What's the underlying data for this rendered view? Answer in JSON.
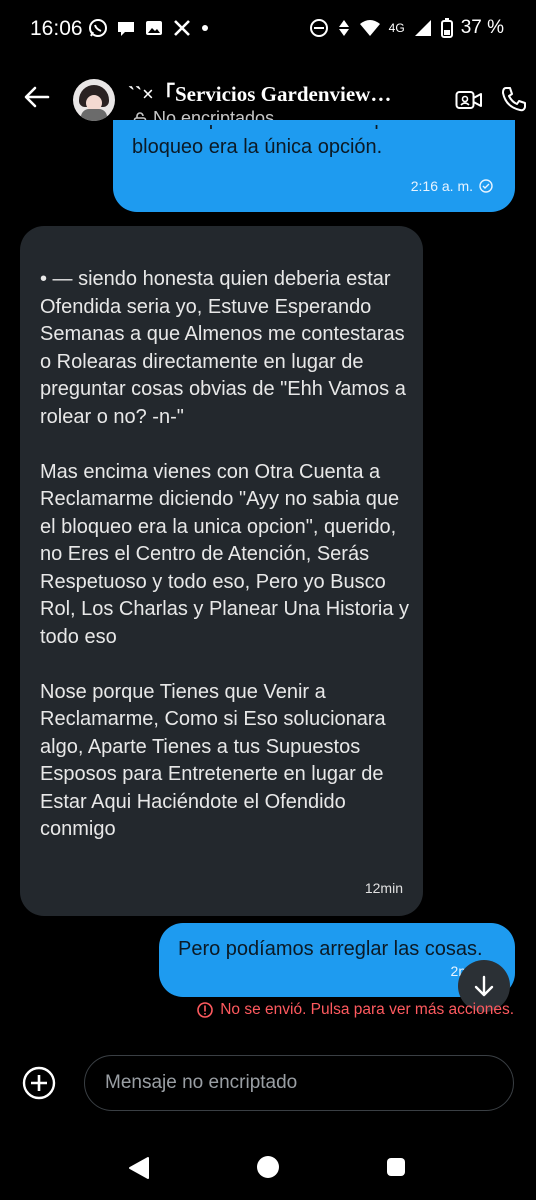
{
  "status_bar": {
    "time": "16:06",
    "network": "4G",
    "battery": "37 %",
    "app_icons": [
      "whatsapp-icon",
      "chat-icon",
      "gallery-icon",
      "x-icon",
      "dot-icon"
    ]
  },
  "header": {
    "contact_name": "``×「Servicios Gardenview…",
    "encryption_status": "No encriptados",
    "icons": [
      "back-arrow-icon",
      "lock-icon",
      "video-call-icon",
      "phone-icon"
    ]
  },
  "messages": [
    {
      "direction": "outgoing",
      "text": "saber el problema... sabia que el bloqueo era la única opción.",
      "time": "2:16 a. m.",
      "status": "sent"
    },
    {
      "direction": "incoming",
      "text": "• — siendo honesta quien deberia estar Ofendida seria yo, Estuve Esperando Semanas a que Almenos me contestaras o Rolearas directamente en lugar de preguntar cosas obvias de \"Ehh Vamos a rolear o no? -n-\"\n\nMas encima vienes con Otra Cuenta a Reclamarme diciendo \"Ayy no sabia que el bloqueo era la unica opcion\", querido, no Eres el Centro de Atención, Serás Respetuoso y todo eso, Pero yo Busco Rol, Los Charlas y Planear Una Historia y todo eso\n\nNose porque Tienes que Venir a Reclamarme, Como si Eso solucionara algo, Aparte Tienes a tus Supuestos Esposos para Entretenerte en lugar de Estar Aqui Haciéndote el Ofendido conmigo",
      "time": "12min"
    },
    {
      "direction": "outgoing",
      "text": "Pero podíamos arreglar las cosas.",
      "time": "2m"
    }
  ],
  "error": {
    "text": "No se envió. Pulsa para ver más acciones."
  },
  "composer": {
    "placeholder": "Mensaje no encriptado"
  },
  "colors": {
    "outgoing": "#1e9bf0",
    "incoming": "#23282d",
    "error": "#ff5a5f",
    "background": "#000000"
  }
}
